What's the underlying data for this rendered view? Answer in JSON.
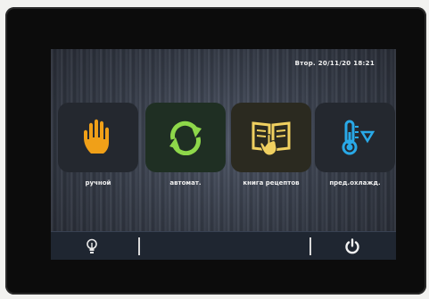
{
  "status_bar": {
    "datetime": "Втор. 20/11/20 18:21"
  },
  "tiles": [
    {
      "label": "ручной",
      "icon": "hand-icon",
      "color": "#f0a018"
    },
    {
      "label": "автомат.",
      "icon": "refresh-arrows-icon",
      "color": "#8ed84a"
    },
    {
      "label": "книга рецептов",
      "icon": "recipe-book-icon",
      "color": "#f0d060"
    },
    {
      "label": "пред.охлажд.",
      "icon": "thermometer-down-icon",
      "color": "#29a9e8"
    }
  ],
  "bottom_bar": {
    "left_icon": "lightbulb-icon",
    "right_icon": "power-icon"
  },
  "colors": {
    "screen_background": "#3a404c",
    "bottom_bar": "#1f2631",
    "bezel": "#0c0c0c"
  }
}
